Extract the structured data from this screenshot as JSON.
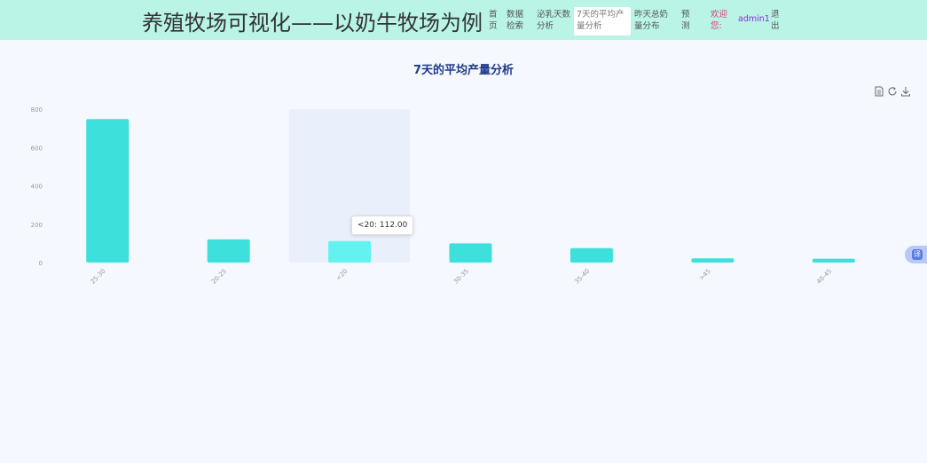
{
  "header": {
    "title": "养殖牧场可视化——以奶牛牧场为例",
    "nav": [
      {
        "label": "首页",
        "active": false
      },
      {
        "label": "数据检索",
        "active": false
      },
      {
        "label": "泌乳天数分析",
        "active": false
      },
      {
        "label": "7天的平均产量分析",
        "active": true
      },
      {
        "label": "昨天总奶量分布",
        "active": false
      },
      {
        "label": "预测",
        "active": false
      }
    ],
    "welcome": "欢迎您:",
    "username": "admin1",
    "logout": "退出"
  },
  "tooltip": {
    "text": "<20: 112.00"
  },
  "colors": {
    "bar": "#3ee0dc",
    "bar_highlight": "#62f2f0",
    "axis_label": "#999999",
    "title": "#1f3a8a",
    "highlight_band": "#eaf0fb"
  },
  "toolbox_icons": [
    "data-view-icon",
    "restore-icon",
    "save-image-icon"
  ],
  "chart_data": {
    "type": "bar",
    "title": "7天的平均产量分析",
    "categories": [
      "25-30",
      "20-25",
      "<20",
      "30-35",
      "35-40",
      ">45",
      "40-45"
    ],
    "values": [
      748,
      121,
      112,
      100,
      75,
      22,
      20
    ],
    "ylim": [
      0,
      800
    ],
    "yticks": [
      0,
      200,
      400,
      600,
      800
    ],
    "highlighted_index": 2,
    "xlabel": "",
    "ylabel": "",
    "grid": false
  }
}
